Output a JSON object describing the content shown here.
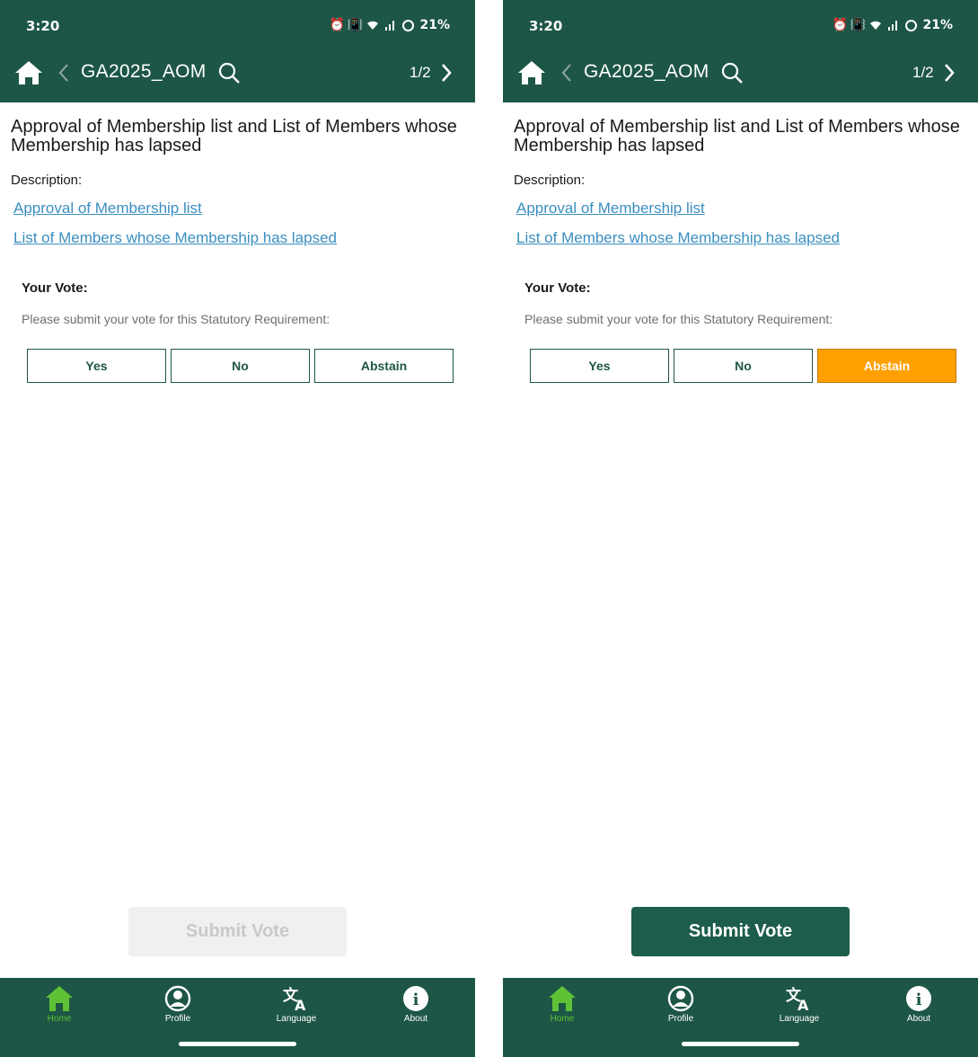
{
  "colors": {
    "primary": "#1d5646",
    "selected_vote": "#ffa000",
    "link": "#3a8fbf",
    "nav_active": "#5fc236"
  },
  "screens": [
    {
      "status": {
        "time": "3:20",
        "battery": "21%"
      },
      "header": {
        "title": "GA2025_AOM",
        "page_indicator": "1/2"
      },
      "item": {
        "title": "Approval of Membership list and List of Members whose Membership has lapsed",
        "description_label": "Description:",
        "links": [
          "Approval of Membership list",
          "List of Members whose Membership has lapsed"
        ]
      },
      "vote": {
        "label": "Your Vote:",
        "prompt": "Please submit your vote for this Statutory Requirement:",
        "options": [
          "Yes",
          "No",
          "Abstain"
        ],
        "selected": null
      },
      "submit": {
        "label": "Submit Vote",
        "enabled": false
      },
      "nav": {
        "items": [
          {
            "label": "Home",
            "icon": "home-icon",
            "active": true
          },
          {
            "label": "Profile",
            "icon": "profile-icon",
            "active": false
          },
          {
            "label": "Language",
            "icon": "translate-icon",
            "active": false
          },
          {
            "label": "About",
            "icon": "info-icon",
            "active": false
          }
        ]
      }
    },
    {
      "status": {
        "time": "3:20",
        "battery": "21%"
      },
      "header": {
        "title": "GA2025_AOM",
        "page_indicator": "1/2"
      },
      "item": {
        "title": "Approval of Membership list and List of Members whose Membership has lapsed",
        "description_label": "Description:",
        "links": [
          "Approval of Membership list",
          "List of Members whose Membership has lapsed"
        ]
      },
      "vote": {
        "label": "Your Vote:",
        "prompt": "Please submit your vote for this Statutory Requirement:",
        "options": [
          "Yes",
          "No",
          "Abstain"
        ],
        "selected": "Abstain"
      },
      "submit": {
        "label": "Submit Vote",
        "enabled": true
      },
      "nav": {
        "items": [
          {
            "label": "Home",
            "icon": "home-icon",
            "active": true
          },
          {
            "label": "Profile",
            "icon": "profile-icon",
            "active": false
          },
          {
            "label": "Language",
            "icon": "translate-icon",
            "active": false
          },
          {
            "label": "About",
            "icon": "info-icon",
            "active": false
          }
        ]
      }
    }
  ]
}
